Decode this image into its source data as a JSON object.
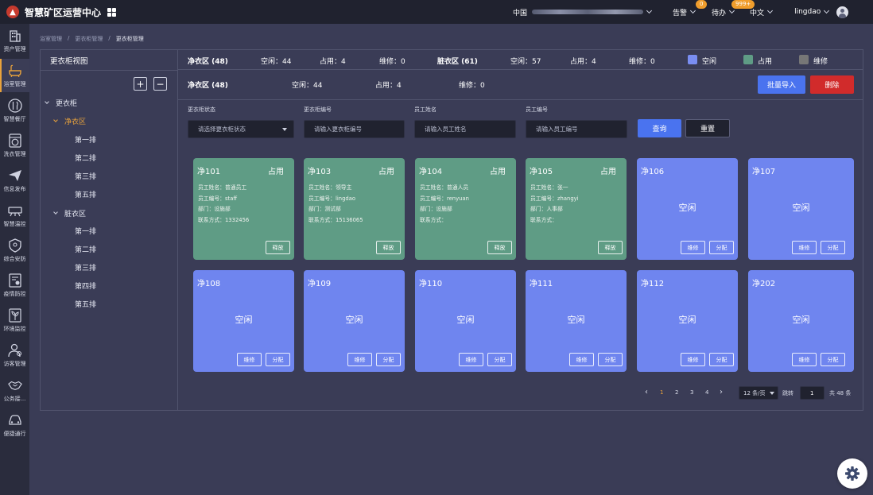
{
  "header": {
    "app_title": "智慧矿区运营中心",
    "region_label": "中国",
    "alarm_label": "告警",
    "alarm_count": "0",
    "todo_label": "待办",
    "todo_count": "999+",
    "language": "中文",
    "username": "lingdao"
  },
  "sidebar": {
    "items": [
      {
        "label": "资产管理",
        "icon": "building-icon"
      },
      {
        "label": "浴室管理",
        "icon": "bathtub-icon"
      },
      {
        "label": "智慧餐厅",
        "icon": "dining-icon"
      },
      {
        "label": "洗衣管理",
        "icon": "washing-machine-icon"
      },
      {
        "label": "信息发布",
        "icon": "paper-plane-icon"
      },
      {
        "label": "智慧温控",
        "icon": "thermostat-icon"
      },
      {
        "label": "综合安防",
        "icon": "shield-icon"
      },
      {
        "label": "疫情防控",
        "icon": "epidemic-icon"
      },
      {
        "label": "环境监控",
        "icon": "plant-icon"
      },
      {
        "label": "访客管理",
        "icon": "visitor-icon"
      },
      {
        "label": "公务接...",
        "icon": "handshake-icon"
      },
      {
        "label": "便捷通行",
        "icon": "car-icon"
      }
    ]
  },
  "breadcrumb": {
    "items": [
      "浴室管理",
      "更衣柜管理",
      "更衣柜管理"
    ]
  },
  "tree": {
    "title": "更衣柜视图",
    "add_symbol": "+",
    "remove_symbol": "−",
    "root": "更衣柜",
    "clean_zone": "净衣区",
    "clean_rows": [
      "第一排",
      "第二排",
      "第三排",
      "第五排"
    ],
    "dirty_zone": "脏衣区",
    "dirty_rows": [
      "第一排",
      "第二排",
      "第三排",
      "第四排",
      "第五排"
    ]
  },
  "summary": {
    "clean_title": "净衣区 (48)",
    "clean_free": "空闲：44",
    "clean_occupied": "占用：4",
    "clean_repair": "维修：0",
    "dirty_title": "脏衣区 (61)",
    "dirty_free": "空闲：57",
    "dirty_occupied": "占用：4",
    "dirty_repair": "维修：0",
    "legend": [
      {
        "label": "空闲",
        "color": "#7a8ef2"
      },
      {
        "label": "占用",
        "color": "#5f9c85"
      },
      {
        "label": "维修",
        "color": "#777777"
      }
    ]
  },
  "zone_bar": {
    "title": "净衣区 (48)",
    "free": "空闲：44",
    "occupied": "占用：4",
    "repair": "维修：0",
    "import_label": "批量导入",
    "delete_label": "删除"
  },
  "filters": {
    "status_label": "更衣柜状态",
    "status_placeholder": "请选择更衣柜状态",
    "locker_no_label": "更衣柜编号",
    "locker_no_placeholder": "请输入更衣柜编号",
    "staff_name_label": "员工姓名",
    "staff_name_placeholder": "请输入员工姓名",
    "staff_no_label": "员工编号",
    "staff_no_placeholder": "请输入员工编号",
    "query_label": "查询",
    "reset_label": "重置"
  },
  "lockers": [
    {
      "no": "净101",
      "status": "占用",
      "info": [
        "员工姓名：普通员工",
        "员工编号：staff",
        "部门：设施部",
        "联系方式：1332456"
      ],
      "actions": [
        "释放"
      ]
    },
    {
      "no": "净103",
      "status": "占用",
      "info": [
        "员工姓名：领导主",
        "员工编号：lingdao",
        "部门：测试部",
        "联系方式：15136065"
      ],
      "actions": [
        "释放"
      ]
    },
    {
      "no": "净104",
      "status": "占用",
      "info": [
        "员工姓名：普通人员",
        "员工编号：renyuan",
        "部门：设施部",
        "联系方式："
      ],
      "actions": [
        "释放"
      ]
    },
    {
      "no": "净105",
      "status": "占用",
      "info": [
        "员工姓名：张一",
        "员工编号：zhangyi",
        "部门：人事部",
        "联系方式："
      ],
      "actions": [
        "释放"
      ]
    },
    {
      "no": "净106",
      "status": "空闲",
      "info": [],
      "actions": [
        "维修",
        "分配"
      ]
    },
    {
      "no": "净107",
      "status": "空闲",
      "info": [],
      "actions": [
        "维修",
        "分配"
      ]
    },
    {
      "no": "净108",
      "status": "空闲",
      "info": [],
      "actions": [
        "维修",
        "分配"
      ]
    },
    {
      "no": "净109",
      "status": "空闲",
      "info": [],
      "actions": [
        "维修",
        "分配"
      ]
    },
    {
      "no": "净110",
      "status": "空闲",
      "info": [],
      "actions": [
        "维修",
        "分配"
      ]
    },
    {
      "no": "净111",
      "status": "空闲",
      "info": [],
      "actions": [
        "维修",
        "分配"
      ]
    },
    {
      "no": "净112",
      "status": "空闲",
      "info": [],
      "actions": [
        "维修",
        "分配"
      ]
    },
    {
      "no": "净202",
      "status": "空闲",
      "info": [],
      "actions": [
        "维修",
        "分配"
      ]
    }
  ],
  "pagination": {
    "prev": "‹",
    "pages": [
      "1",
      "2",
      "3",
      "4"
    ],
    "current": "1",
    "next": "›",
    "page_size": "12 条/页",
    "jump_label": "跳转",
    "jump_value": "1",
    "total": "共 48 条"
  }
}
